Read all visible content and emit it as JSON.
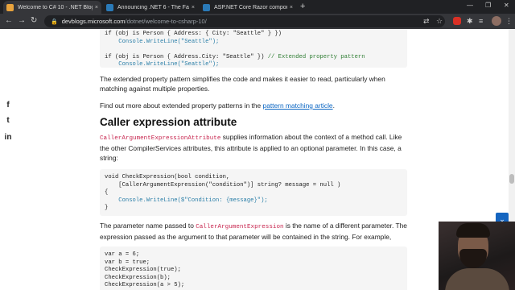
{
  "tabs": [
    {
      "title": "Welcome to C# 10 - .NET Blog",
      "favicon_color": "#e8a33d",
      "active": true
    },
    {
      "title": "Announcing .NET 6 - The Fastest...",
      "favicon_color": "#2a7ab8",
      "active": false
    },
    {
      "title": "ASP.NET Core Razor component...",
      "favicon_color": "#2a7ab8",
      "active": false
    }
  ],
  "toolbar": {
    "back": "←",
    "forward": "→",
    "reload": "↻",
    "lock": "🔒",
    "url_host": "devblogs.microsoft.com",
    "url_path": "/dotnet/welcome-to-csharp-10/"
  },
  "window": {
    "minimize": "—",
    "restore": "❐",
    "close": "✕",
    "new_tab": "+",
    "tab_close": "×"
  },
  "social": {
    "facebook": "f",
    "twitter": "t",
    "linkedin": "in"
  },
  "content": {
    "code1_line1_a": "if (obj is Person { Address: { City: \"Seattle\" } })",
    "code1_line2": "    Console.WriteLine(\"Seattle\");",
    "code1_line3_a": "if (obj is Person { Address.City: \"Seattle\" })",
    "code1_line3_b": " // Extended property pattern",
    "code1_line4": "    Console.WriteLine(\"Seattle\");",
    "para1": "The extended property pattern simplifies the code and makes it easier to read, particularly when matching against multiple properties.",
    "para2_prefix": "Find out more about extended property patterns in the ",
    "para2_link": "pattern matching article",
    "para2_suffix": ".",
    "heading": "Caller expression attribute",
    "para3_code": "CallerArgumentExpressionAttribute",
    "para3_text": " supplies information about the context of a method call. Like the other CompilerServices attributes, this attribute is applied to an optional parameter. In this case, a string:",
    "code2_l1": "void CheckExpression(bool condition,",
    "code2_l2": "    [CallerArgumentExpression(\"condition\")] string? message = null )",
    "code2_l3": "{",
    "code2_l4": "    Console.WriteLine($\"Condition: {message}\");",
    "code2_l5": "}",
    "para4_prefix": "The parameter name passed to ",
    "para4_code": "CallerArgumentExpression",
    "para4_suffix": " is the name of a different parameter. The expression passed as the argument to that parameter will be contained in the string. For example,",
    "code3_l1": "var a = 6;",
    "code3_l2": "var b = true;",
    "code3_l3": "CheckExpression(true);",
    "code3_l4": "CheckExpression(b);",
    "code3_l5": "CheckExpression(a > 5);"
  },
  "back_to_top": "⌄"
}
